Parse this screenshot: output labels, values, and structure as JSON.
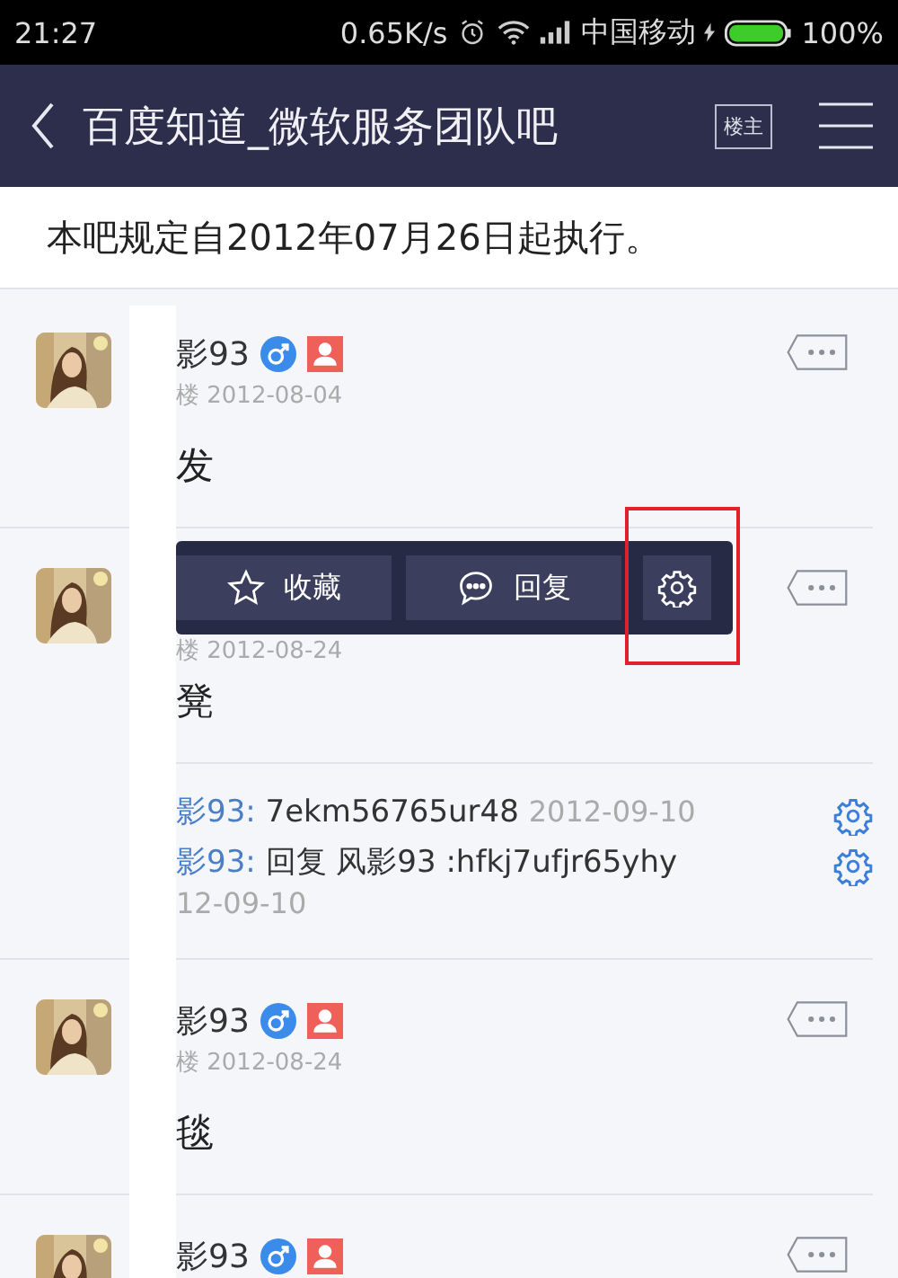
{
  "status_bar": {
    "time": "21:27",
    "speed": "0.65K/s",
    "carrier": "中国移动",
    "battery": "100%"
  },
  "nav": {
    "title": "百度知道_微软服务团队吧",
    "owner_button": "楼主"
  },
  "notice": "本吧规定自2012年07月26日起执行。",
  "posts": [
    {
      "name": "影93",
      "meta": "楼 2012-08-04",
      "content": "发",
      "popup": false
    },
    {
      "meta": "楼 2012-08-24",
      "content": "凳",
      "popup": true,
      "replies": [
        {
          "author": "影93:",
          "text": "7ekm56765ur48",
          "time": "2012-09-10"
        },
        {
          "author": "影93:",
          "text": "回复 风影93 :hfkj7ufjr65yhy",
          "time": "12-09-10"
        }
      ]
    },
    {
      "name": "影93",
      "meta": "楼 2012-08-24",
      "content": "毯",
      "popup": false
    },
    {
      "name": "影93",
      "popup": false
    }
  ],
  "popup": {
    "highlight": true,
    "buttons": [
      {
        "kind": "star",
        "label": "收藏"
      },
      {
        "kind": "comment",
        "label": "回复"
      },
      {
        "kind": "gear"
      }
    ]
  }
}
